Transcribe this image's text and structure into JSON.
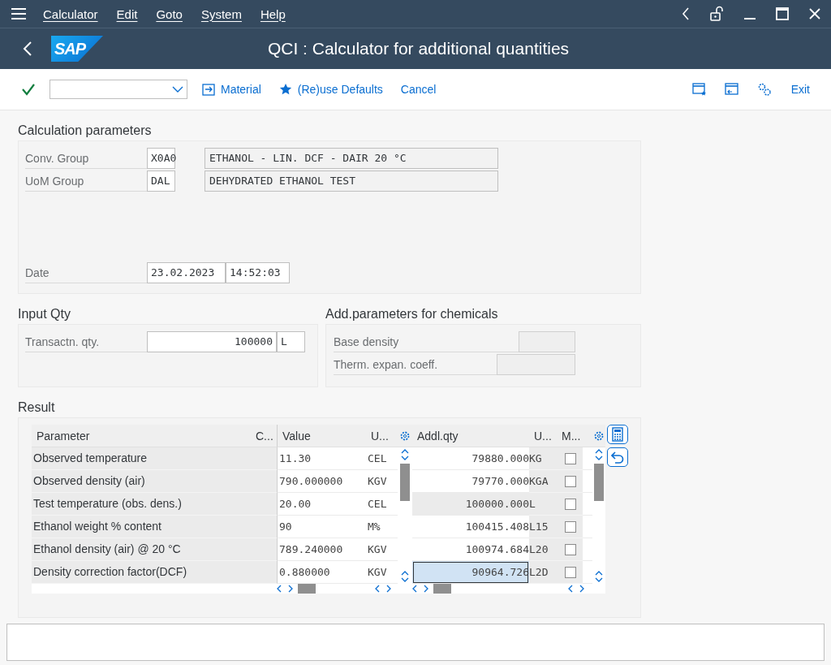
{
  "menu_bar": {
    "items": [
      {
        "label": "Calculator"
      },
      {
        "label": "Edit"
      },
      {
        "label": "Goto"
      },
      {
        "label": "System"
      },
      {
        "label": "Help"
      }
    ]
  },
  "title_bar": {
    "title": "QCI : Calculator for additional quantities",
    "logo": "SAP"
  },
  "toolbar": {
    "buttons": [
      {
        "label": "Material"
      },
      {
        "label": "(Re)use Defaults"
      },
      {
        "label": "Cancel"
      }
    ],
    "exit": "Exit"
  },
  "calculation_parameters": {
    "title": "Calculation parameters",
    "fields": [
      {
        "label": "Conv. Group",
        "value": "X0A0",
        "description": "ETHANOL - LIN. DCF - DAIR 20 °C"
      },
      {
        "label": "UoM Group",
        "value": "DAL",
        "description": "DEHYDRATED ETHANOL TEST"
      }
    ],
    "date": {
      "label": "Date",
      "value": "23.02.2023",
      "time": "14:52:03"
    }
  },
  "input_qty": {
    "title": "Input Qty",
    "label": "Transactn. qty.",
    "value": "100000",
    "unit": "L"
  },
  "chemicals": {
    "title": "Add.parameters for chemicals",
    "fields": [
      {
        "label": "Base density"
      },
      {
        "label": "Therm. expan. coeff."
      }
    ]
  },
  "result": {
    "title": "Result",
    "parameters_table": {
      "columns": [
        "Parameter",
        "C...",
        "Value",
        "U..."
      ],
      "rows": [
        {
          "parameter": "Observed temperature",
          "value": "11.30",
          "unit": "CEL"
        },
        {
          "parameter": "Observed density (air)",
          "value": "790.000000",
          "unit": "KGV"
        },
        {
          "parameter": "Test temperature (obs. dens.)",
          "value": "20.00",
          "unit": "CEL"
        },
        {
          "parameter": "Ethanol weight % content",
          "value": "90",
          "unit": "M%"
        },
        {
          "parameter": "Ethanol density (air) @ 20 °C",
          "value": "789.240000",
          "unit": "KGV"
        },
        {
          "parameter": "Density correction factor(DCF)",
          "value": "0.880000",
          "unit": "KGV"
        }
      ]
    },
    "quantities_table": {
      "columns": [
        "Addl.qty",
        "U...",
        "M..."
      ],
      "rows": [
        {
          "quantity": "79880.000",
          "unit": "KG",
          "checked": false,
          "readonly": false,
          "selected": false
        },
        {
          "quantity": "79770.000",
          "unit": "KGA",
          "checked": false,
          "readonly": false,
          "selected": false
        },
        {
          "quantity": "100000.000",
          "unit": "L",
          "checked": false,
          "readonly": true,
          "selected": false
        },
        {
          "quantity": "100415.408",
          "unit": "L15",
          "checked": false,
          "readonly": false,
          "selected": false
        },
        {
          "quantity": "100974.684",
          "unit": "L20",
          "checked": false,
          "readonly": false,
          "selected": false
        },
        {
          "quantity": "90964.726",
          "unit": "L2D",
          "checked": false,
          "readonly": false,
          "selected": true
        }
      ]
    }
  }
}
